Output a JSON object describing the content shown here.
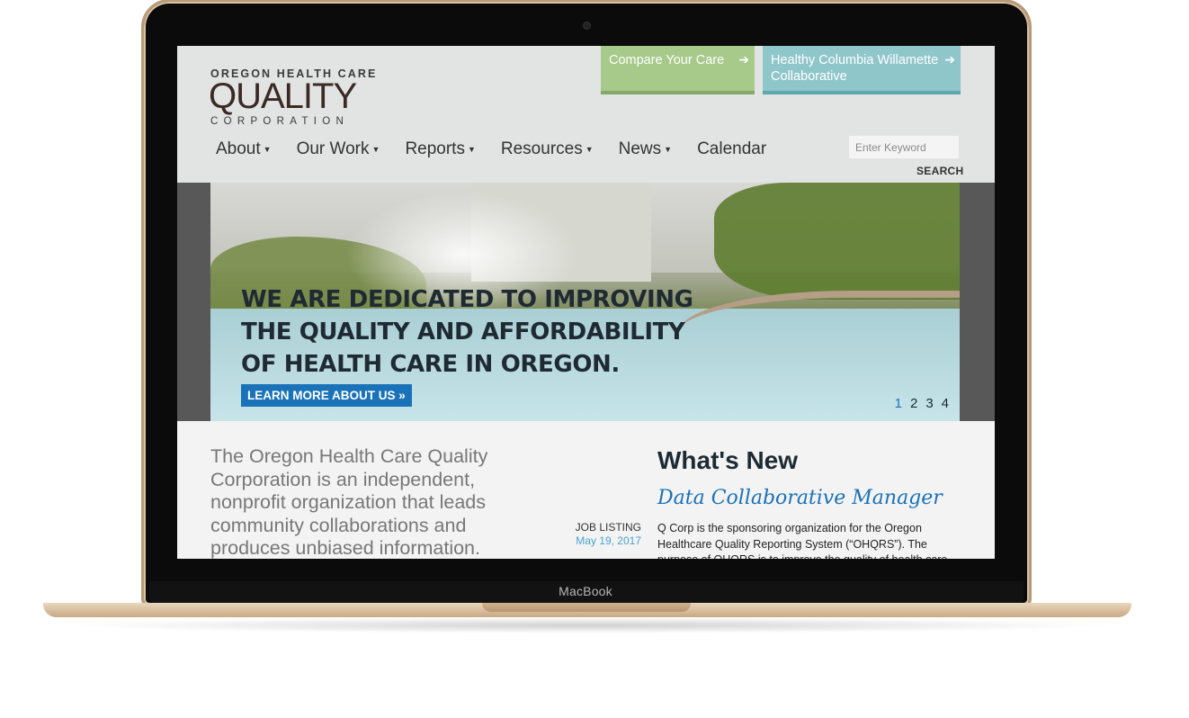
{
  "device": {
    "label": "MacBook"
  },
  "logo": {
    "line1": "OREGON HEALTH CARE",
    "line2": "QUALITY",
    "line3": "CORPORATION"
  },
  "cta": [
    {
      "label": "Compare Your Care",
      "color": "#a7c98a",
      "icon": "arrow-right-icon"
    },
    {
      "label": "Healthy Columbia Willamette Collaborative",
      "color": "#8fc6ca",
      "icon": "arrow-right-icon"
    }
  ],
  "nav": [
    {
      "label": "About",
      "dropdown": true
    },
    {
      "label": "Our Work",
      "dropdown": true
    },
    {
      "label": "Reports",
      "dropdown": true
    },
    {
      "label": "Resources",
      "dropdown": true
    },
    {
      "label": "News",
      "dropdown": true
    },
    {
      "label": "Calendar",
      "dropdown": false
    }
  ],
  "search": {
    "placeholder": "Enter Keyword",
    "button": "SEARCH"
  },
  "hero": {
    "headline_lines": [
      "WE ARE DEDICATED TO IMPROVING",
      "THE QUALITY AND AFFORDABILITY",
      "OF HEALTH CARE IN OREGON."
    ],
    "button": "LEARN MORE ABOUT US »",
    "slides": [
      "1",
      "2",
      "3",
      "4"
    ],
    "active_slide": "1"
  },
  "intro": {
    "text": "The Oregon Health Care Quality Corporation is an independent, nonprofit organization that leads community collaborations and produces unbiased information."
  },
  "whats_new": {
    "title": "What's New",
    "item": {
      "headline": "Data Collaborative Manager",
      "tag": "JOB LISTING",
      "date": "May 19, 2017",
      "body": "Q Corp is the sponsoring organization for the Oregon Healthcare Quality Reporting System (“OHQRS”). The purpose of OHQRS is to improve the quality of health care and"
    }
  },
  "colors": {
    "accent_blue": "#1a72b8",
    "header_bg": "#e2e3e3"
  }
}
